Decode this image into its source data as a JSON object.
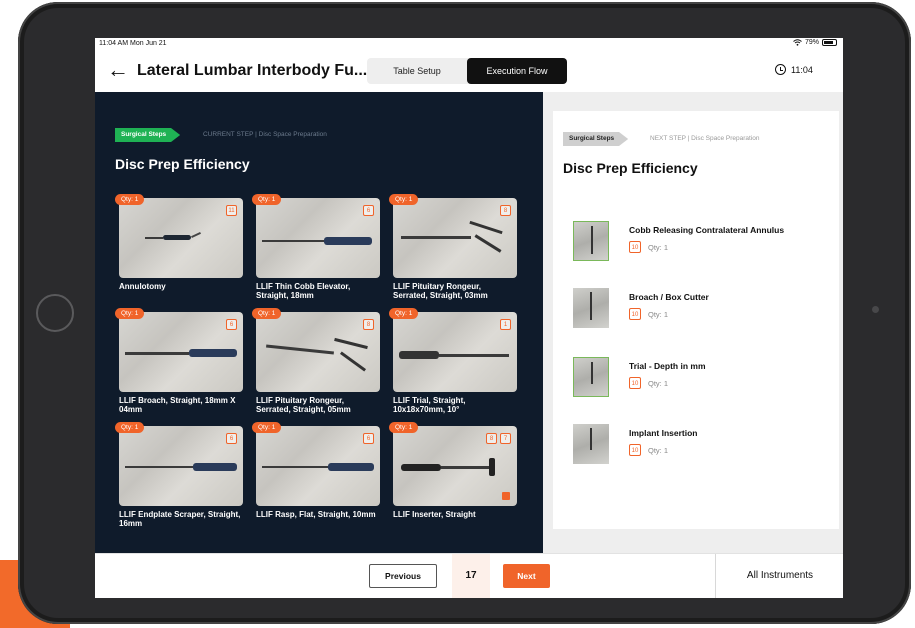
{
  "status_bar": {
    "time": "11:04 AM  Mon Jun 21",
    "battery": "79%",
    "battery_level": 0.79
  },
  "header": {
    "title": "Lateral Lumbar Interbody Fu...",
    "tabs": [
      {
        "label": "Table Setup"
      },
      {
        "label": "Execution Flow"
      }
    ],
    "timer": "11:04"
  },
  "left": {
    "tag": "Surgical Steps",
    "step": "CURRENT STEP | Disc Space Preparation",
    "title": "Disc Prep Efficiency",
    "instruments": [
      {
        "qty": "Qty: 1",
        "num": "11",
        "label": "Annulotomy"
      },
      {
        "qty": "Qty: 1",
        "num": "6",
        "label": "LLIF Thin Cobb Elevator, Straight, 18mm"
      },
      {
        "qty": "Qty: 1",
        "num": "8",
        "label": "LLIF Pituitary Rongeur, Serrated, Straight, 03mm"
      },
      {
        "qty": "Qty: 1",
        "num": "6",
        "label": "LLIF Broach, Straight, 18mm X 04mm"
      },
      {
        "qty": "Qty: 1",
        "num": "8",
        "label": "LLIF Pituitary Rongeur, Serrated, Straight, 05mm"
      },
      {
        "qty": "Qty: 1",
        "num": "1",
        "label": "LLIF Trial, Straight, 10x18x70mm, 10°"
      },
      {
        "qty": "Qty: 1",
        "num": "6",
        "label": "LLIF Endplate Scraper, Straight, 16mm"
      },
      {
        "qty": "Qty: 1",
        "num": "6",
        "label": "LLIF Rasp, Flat, Straight, 10mm"
      },
      {
        "qty": "Qty: 1",
        "num": "8",
        "num2": "7",
        "label": "LLIF Inserter, Straight"
      }
    ]
  },
  "right": {
    "tag": "Surgical Steps",
    "step": "NEXT STEP | Disc Space Preparation",
    "title": "Disc Prep Efficiency",
    "items": [
      {
        "name": "Cobb Releasing Contralateral Annulus",
        "num": "10",
        "qty": "Qty: 1"
      },
      {
        "name": "Broach / Box Cutter",
        "num": "10",
        "qty": "Qty: 1"
      },
      {
        "name": "Trial - Depth in mm",
        "num": "10",
        "qty": "Qty: 1"
      },
      {
        "name": "Implant Insertion",
        "num": "10",
        "qty": "Qty: 1"
      }
    ]
  },
  "footer": {
    "previous": "Previous",
    "page": "17",
    "next": "Next",
    "all_instruments": "All Instruments"
  },
  "colors": {
    "accent": "#f0642a",
    "green": "#1fb254",
    "dark_panel": "#0f1b2b"
  },
  "icons": [
    "back-arrow-icon",
    "clock-icon",
    "wifi-icon",
    "battery-icon",
    "flag-icon"
  ]
}
